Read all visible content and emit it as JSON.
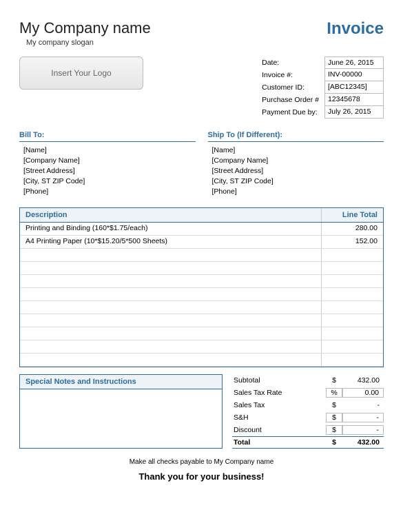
{
  "header": {
    "company_name": "My Company name",
    "slogan": "My company slogan",
    "title": "Invoice",
    "logo_placeholder": "Insert Your Logo"
  },
  "meta": {
    "labels": {
      "date": "Date:",
      "invoice_no": "Invoice #:",
      "customer_id": "Customer ID:",
      "po": "Purchase Order #",
      "due": "Payment Due by:"
    },
    "values": {
      "date": "June 26, 2015",
      "invoice_no": "INV-00000",
      "customer_id": "[ABC12345]",
      "po": "12345678",
      "due": "July 26, 2015"
    }
  },
  "billto": {
    "title": "Bill To:",
    "name": "[Name]",
    "company": "[Company Name]",
    "street": "[Street Address]",
    "city": "[City, ST ZIP Code]",
    "phone": "[Phone]"
  },
  "shipto": {
    "title": "Ship To (If Different):",
    "name": "[Name]",
    "company": "[Company Name]",
    "street": "[Street Address]",
    "city": "[City, ST ZIP Code]",
    "phone": "[Phone]"
  },
  "items": {
    "desc_header": "Description",
    "total_header": "Line Total",
    "rows": [
      {
        "desc": "Printing and Binding (160*$1.75/each)",
        "total": "280.00"
      },
      {
        "desc": "A4 Printing Paper (10*$15.20/5*500 Sheets)",
        "total": "152.00"
      }
    ]
  },
  "notes": {
    "title": "Special Notes and Instructions"
  },
  "totals": {
    "subtotal_l": "Subtotal",
    "subtotal_s": "$",
    "subtotal_v": "432.00",
    "tax_rate_l": "Sales Tax Rate",
    "tax_rate_s": "%",
    "tax_rate_v": "0.00",
    "tax_l": "Sales Tax",
    "tax_s": "$",
    "tax_v": "-",
    "sh_l": "S&H",
    "sh_s": "$",
    "sh_v": "-",
    "disc_l": "Discount",
    "disc_s": "$",
    "disc_v": "-",
    "total_l": "Total",
    "total_s": "$",
    "total_v": "432.00"
  },
  "footer": {
    "payable": "Make all checks payable to My Company name",
    "thanks": "Thank you for your business!"
  }
}
